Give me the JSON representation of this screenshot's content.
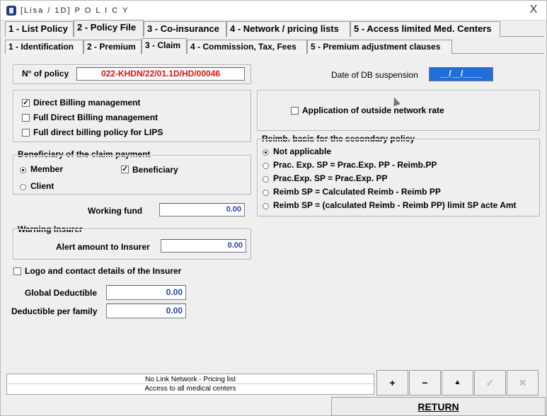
{
  "window": {
    "title": "[Lisa / 1D]  P O L I C Y",
    "close": "X"
  },
  "tabs_main": [
    "1 - List Policy",
    "2 - Policy File",
    "3 - Co-insurance",
    "4 - Network / pricing lists",
    "5 - Access limited Med. Centers"
  ],
  "tabs_main_active": "2 - Policy File",
  "tabs_sub": [
    "1 - Identification",
    "2 - Premium",
    "3 - Claim",
    "4 - Commission, Tax, Fees",
    "5 - Premium adjustment clauses"
  ],
  "tabs_sub_active": "3 - Claim",
  "policy": {
    "label": "N° of policy",
    "value": "022-KHDN/22/01.1D/HD/00046"
  },
  "db_suspension": {
    "label": "Date of DB suspension",
    "value": "__/__/____"
  },
  "billing": [
    {
      "label": "Direct Billing management",
      "checked": true
    },
    {
      "label": "Full Direct Billing management",
      "checked": false
    },
    {
      "label": "Full direct billing policy for LIPS",
      "checked": false
    }
  ],
  "outside_network": {
    "label": "Application of outside network rate",
    "checked": false
  },
  "beneficiary": {
    "title": "Beneficiary of the claim payment",
    "member": {
      "label": "Member",
      "selected": true
    },
    "client": {
      "label": "Client",
      "selected": false
    },
    "beneficiary": {
      "label": "Beneficiary",
      "checked": true
    }
  },
  "reimb": {
    "title": "Reimb. basis for the secondary policy",
    "options": [
      {
        "label": "Not applicable",
        "selected": true
      },
      {
        "label": "Prac. Exp. SP = Prac.Exp. PP - Reimb.PP",
        "selected": false
      },
      {
        "label": "Prac.Exp. SP = Prac.Exp. PP",
        "selected": false
      },
      {
        "label": "Reimb SP = Calculated Reimb - Reimb PP",
        "selected": false
      },
      {
        "label": "Reimb SP = (calculated Reimb - Reimb PP) limit SP acte Amt",
        "selected": false
      }
    ]
  },
  "working_fund": {
    "label": "Working fund",
    "value": "0.00"
  },
  "warning": {
    "title": "Warning Insurer",
    "alert_label": "Alert amount to Insurer",
    "alert_value": "0.00"
  },
  "logo": {
    "label": "Logo and contact details of the Insurer",
    "checked": false
  },
  "global_deductible": {
    "label": "Global Deductible",
    "value": "0.00"
  },
  "family_deductible": {
    "label": "Deductible per family",
    "value": "0.00"
  },
  "network_list": [
    "No Link Network - Pricing list",
    "Access to all medical centers"
  ],
  "buttons": {
    "add": "+",
    "remove": "−",
    "up": "▲",
    "check": "✓",
    "cancel": "✕"
  },
  "return_label": "RETURN"
}
